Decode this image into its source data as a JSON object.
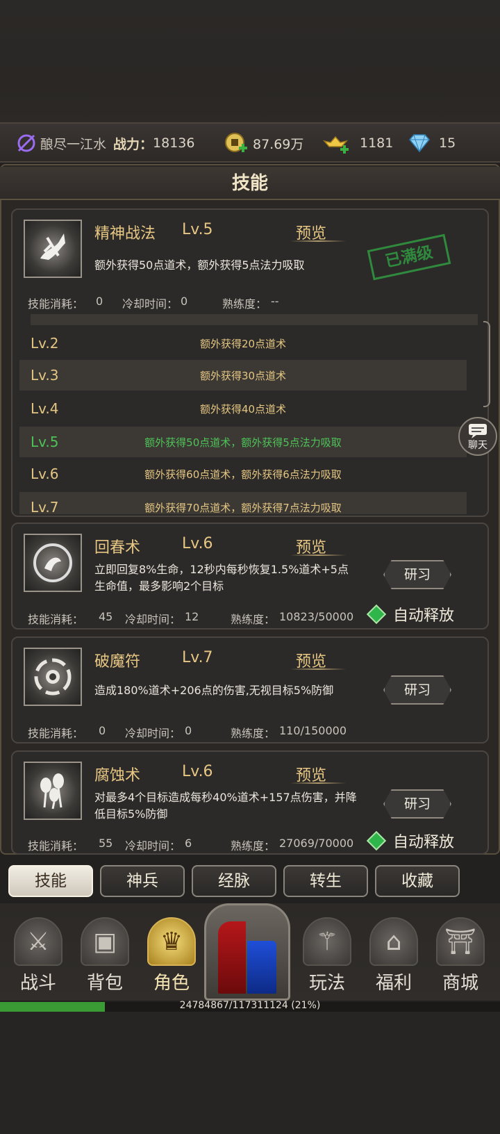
{
  "status": {
    "player_name": "酿尽一江水",
    "power_label": "战力：",
    "power_value": "18136",
    "coins": "87.69万",
    "ingots": "1181",
    "diamonds": "15"
  },
  "panel_title": "技能",
  "expanded_skill": {
    "name": "精神战法",
    "level": "Lv.5",
    "preview": "预览",
    "description": "额外获得50点道术，额外获得5点法力吸取",
    "maxed_stamp": "已满级",
    "cost_label": "技能消耗：",
    "cost": "0",
    "cooldown_label": "冷却时间：",
    "cooldown": "0",
    "proficiency_label": "熟练度：",
    "proficiency": "--",
    "levels": [
      {
        "lv": "Lv.2",
        "desc": "额外获得20点道术"
      },
      {
        "lv": "Lv.3",
        "desc": "额外获得30点道术"
      },
      {
        "lv": "Lv.4",
        "desc": "额外获得40点道术"
      },
      {
        "lv": "Lv.5",
        "desc": "额外获得50点道术，额外获得5点法力吸取"
      },
      {
        "lv": "Lv.6",
        "desc": "额外获得60点道术，额外获得6点法力吸取"
      },
      {
        "lv": "Lv.7",
        "desc": "额外获得70点道术，额外获得7点法力吸取"
      }
    ]
  },
  "skills": [
    {
      "name": "回春术",
      "level": "Lv.6",
      "preview": "预览",
      "description": "立即回复8%生命，12秒内每秒恢复1.5%道术+5点生命值，最多影响2个目标",
      "cost_label": "技能消耗：",
      "cost": "45",
      "cooldown_label": "冷却时间：",
      "cooldown": "12",
      "proficiency_label": "熟练度：",
      "proficiency": "10823/50000",
      "study": "研习",
      "auto": "自动释放"
    },
    {
      "name": "破魔符",
      "level": "Lv.7",
      "preview": "预览",
      "description": "造成180%道术+206点的伤害,无视目标5%防御",
      "cost_label": "技能消耗：",
      "cost": "0",
      "cooldown_label": "冷却时间：",
      "cooldown": "0",
      "proficiency_label": "熟练度：",
      "proficiency": "110/150000",
      "study": "研习"
    },
    {
      "name": "腐蚀术",
      "level": "Lv.6",
      "preview": "预览",
      "description": "对最多4个目标造成每秒40%道术+157点伤害，并降低目标5%防御",
      "cost_label": "技能消耗：",
      "cost": "55",
      "cooldown_label": "冷却时间：",
      "cooldown": "6",
      "proficiency_label": "熟练度：",
      "proficiency": "27069/70000",
      "study": "研习",
      "auto": "自动释放"
    }
  ],
  "chat_label": "聊天",
  "tabs": [
    "技能",
    "神兵",
    "经脉",
    "转生",
    "收藏"
  ],
  "nav": [
    "战斗",
    "背包",
    "角色",
    "玩法",
    "福利",
    "商城"
  ],
  "xp": {
    "text": "24784867/117311124 (21%)",
    "fraction": 0.21
  },
  "colors": {
    "gold": "#e7c784",
    "active_green": "#4ec257",
    "stamp_green": "#2f8a3e"
  }
}
